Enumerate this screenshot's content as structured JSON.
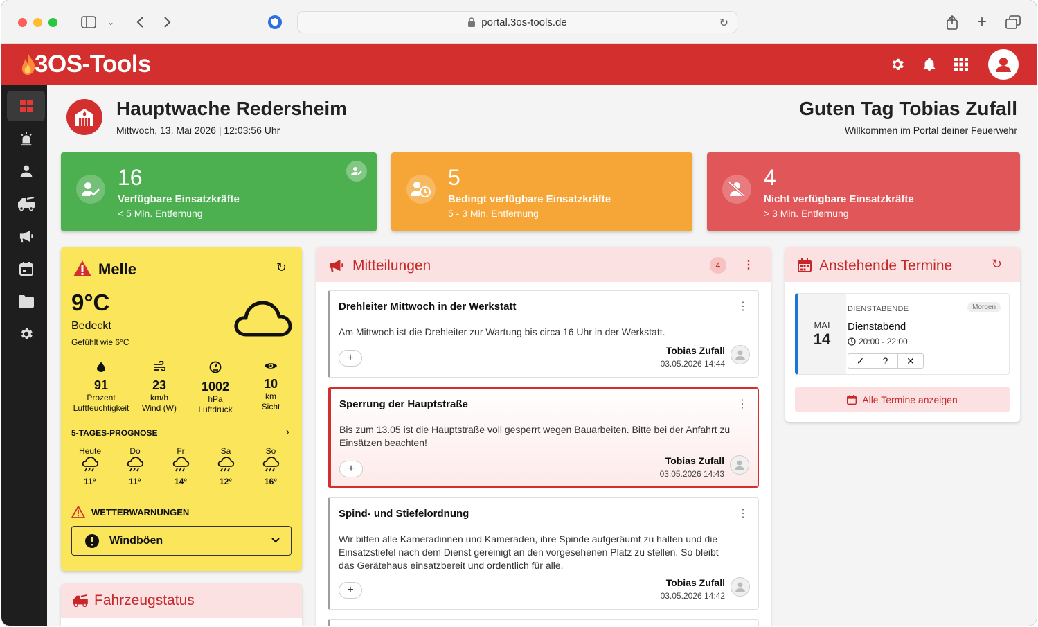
{
  "browser": {
    "url": "portal.3os-tools.de"
  },
  "app": {
    "logo_text": "3OS-Tools",
    "accent": "#d32f2f"
  },
  "station": {
    "name": "Hauptwache Redersheim",
    "datetime": "Mittwoch, 13. Mai 2026 | 12:03:56 Uhr"
  },
  "greeting": {
    "title": "Guten Tag Tobias Zufall",
    "subtitle": "Willkommen im Portal deiner Feuerwehr"
  },
  "stats": [
    {
      "count": "16",
      "label": "Verfügbare Einsatzkräfte",
      "sub": "< 5 Min. Entfernung",
      "color": "#4caf50"
    },
    {
      "count": "5",
      "label": "Bedingt verfügbare Einsatzkräfte",
      "sub": "5 - 3 Min. Entfernung",
      "color": "#f5a637"
    },
    {
      "count": "4",
      "label": "Nicht verfügbare Einsatzkräfte",
      "sub": "> 3 Min. Entfernung",
      "color": "#e15759"
    }
  ],
  "weather": {
    "city": "Melle",
    "temp": "9°C",
    "desc": "Bedeckt",
    "feels": "Gefühlt wie 6°C",
    "metrics": [
      {
        "value": "91",
        "unit": "Prozent",
        "label": "Luftfeuchtigkeit",
        "icon": "drop-icon"
      },
      {
        "value": "23",
        "unit": "km/h",
        "label": "Wind (W)",
        "icon": "wind-icon"
      },
      {
        "value": "1002",
        "unit": "hPa",
        "label": "Luftdruck",
        "icon": "gauge-icon"
      },
      {
        "value": "10",
        "unit": "km",
        "label": "Sicht",
        "icon": "eye-icon"
      }
    ],
    "forecast_title": "5-TAGES-PROGNOSE",
    "forecast": [
      {
        "day": "Heute",
        "temp": "11°"
      },
      {
        "day": "Do",
        "temp": "11°"
      },
      {
        "day": "Fr",
        "temp": "14°"
      },
      {
        "day": "Sa",
        "temp": "12°"
      },
      {
        "day": "So",
        "temp": "16°"
      }
    ],
    "warnings_title": "WETTERWARNUNGEN",
    "warning": "Windböen"
  },
  "vehicles": {
    "title": "Fahrzeugstatus"
  },
  "messages": {
    "title": "Mitteilungen",
    "count": "4",
    "items": [
      {
        "title": "Drehleiter Mittwoch in der Werkstatt",
        "body": "Am Mittwoch ist die Drehleiter zur Wartung bis circa 16 Uhr in der Werkstatt.",
        "author": "Tobias Zufall",
        "date": "03.05.2026 14:44"
      },
      {
        "title": "Sperrung der Hauptstraße",
        "body": "Bis zum 13.05 ist die Hauptstraße voll gesperrt wegen Bauarbeiten. Bitte bei der Anfahrt zu Einsätzen beachten!",
        "author": "Tobias Zufall",
        "date": "03.05.2026 14:43"
      },
      {
        "title": "Spind- und Stiefelordnung",
        "body": "Wir bitten alle Kameradinnen und Kameraden, ihre Spinde aufgeräumt zu halten und die Einsatzstiefel nach dem Dienst gereinigt an den vorgesehenen Platz zu stellen. So bleibt das Gerätehaus einsatzbereit und ordentlich für alle.",
        "author": "Tobias Zufall",
        "date": "03.05.2026 14:42"
      }
    ],
    "plus": "+"
  },
  "events": {
    "title": "Anstehende Termine",
    "item": {
      "month": "MAI",
      "day": "14",
      "category": "DIENSTABENDE",
      "badge": "Morgen",
      "name": "Dienstabend",
      "time": "20:00 - 22:00",
      "rsvp": [
        "✓",
        "?",
        "✕"
      ]
    },
    "all_button": "Alle Termine anzeigen"
  }
}
